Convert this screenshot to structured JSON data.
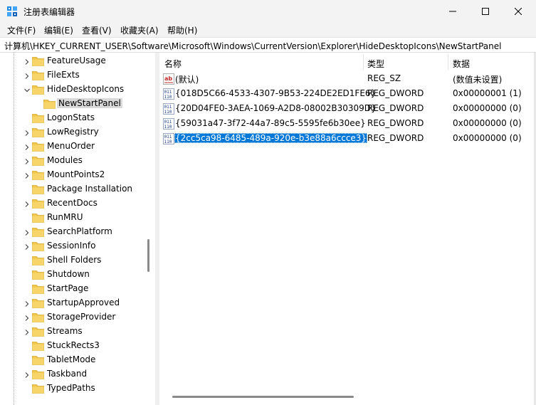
{
  "window": {
    "title": "注册表编辑器",
    "icon": "regedit-icon",
    "controls": [
      "minimize-icon",
      "maximize-icon",
      "close-icon"
    ]
  },
  "menu": [
    "文件(F)",
    "编辑(E)",
    "查看(V)",
    "收藏夹(A)",
    "帮助(H)"
  ],
  "address": "计算机\\HKEY_CURRENT_USER\\Software\\Microsoft\\Windows\\CurrentVersion\\Explorer\\HideDesktopIcons\\NewStartPanel",
  "tree": [
    {
      "label": "FeatureUsage",
      "expander": "chevron-right-icon"
    },
    {
      "label": "FileExts",
      "expander": "chevron-right-icon"
    },
    {
      "label": "HideDesktopIcons",
      "expander": "chevron-down-icon"
    },
    {
      "label": "NewStartPanel",
      "expander": "",
      "selected": true,
      "child": true
    },
    {
      "label": "LogonStats",
      "expander": ""
    },
    {
      "label": "LowRegistry",
      "expander": "chevron-right-icon"
    },
    {
      "label": "MenuOrder",
      "expander": "chevron-right-icon"
    },
    {
      "label": "Modules",
      "expander": "chevron-right-icon"
    },
    {
      "label": "MountPoints2",
      "expander": "chevron-right-icon"
    },
    {
      "label": "Package Installation",
      "expander": ""
    },
    {
      "label": "RecentDocs",
      "expander": "chevron-right-icon"
    },
    {
      "label": "RunMRU",
      "expander": ""
    },
    {
      "label": "SearchPlatform",
      "expander": "chevron-right-icon"
    },
    {
      "label": "SessionInfo",
      "expander": "chevron-right-icon"
    },
    {
      "label": "Shell Folders",
      "expander": ""
    },
    {
      "label": "Shutdown",
      "expander": ""
    },
    {
      "label": "StartPage",
      "expander": ""
    },
    {
      "label": "StartupApproved",
      "expander": "chevron-right-icon"
    },
    {
      "label": "StorageProvider",
      "expander": "chevron-right-icon"
    },
    {
      "label": "Streams",
      "expander": "chevron-right-icon"
    },
    {
      "label": "StuckRects3",
      "expander": ""
    },
    {
      "label": "TabletMode",
      "expander": ""
    },
    {
      "label": "Taskband",
      "expander": "chevron-right-icon"
    },
    {
      "label": "TypedPaths",
      "expander": ""
    }
  ],
  "columns": [
    "名称",
    "类型",
    "数据"
  ],
  "values": [
    {
      "icon": "string-value-icon",
      "name": "(默认)",
      "type": "REG_SZ",
      "data": "(数值未设置)",
      "selected": false
    },
    {
      "icon": "binary-value-icon",
      "name": "{018D5C66-4533-4307-9B53-224DE2ED1FE6}",
      "type": "REG_DWORD",
      "data": "0x00000001 (1)",
      "selected": false
    },
    {
      "icon": "binary-value-icon",
      "name": "{20D04FE0-3AEA-1069-A2D8-08002B30309D}",
      "type": "REG_DWORD",
      "data": "0x00000000 (0)",
      "selected": false
    },
    {
      "icon": "binary-value-icon",
      "name": "{59031a47-3f72-44a7-89c5-5595fe6b30ee}",
      "type": "REG_DWORD",
      "data": "0x00000000 (0)",
      "selected": false
    },
    {
      "icon": "binary-value-icon",
      "name": "{2cc5ca98-6485-489a-920e-b3e88a6ccce3}",
      "type": "REG_DWORD",
      "data": "0x00000000 (0)",
      "selected": true
    }
  ],
  "colors": {
    "chrome": "#f3f3f3",
    "selection": "#0078d7",
    "tree_selection": "#d9d9d9",
    "folder": "#f2c649"
  }
}
